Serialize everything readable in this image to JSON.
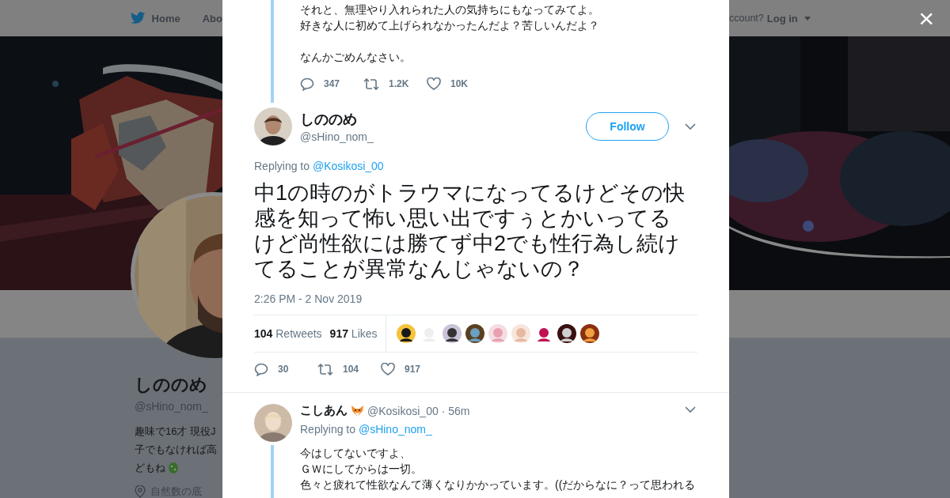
{
  "background_page": {
    "nav": {
      "home": "Home",
      "about": "Abo",
      "account_prompt": "ccount?",
      "login": "Log in"
    },
    "profile": {
      "name": "しののめ",
      "handle": "@sHino_nom_",
      "bio": [
        "趣味で16才 現役J",
        "子でもなければ高",
        "どもね"
      ],
      "location": "自然数の底"
    }
  },
  "close_button": "×",
  "previous_tweet": {
    "paragraphs": [
      [
        "それと、無理やり入れられた人の気持ちにもなってみてよ。",
        "好きな人に初めて上げられなかったんだよ？苦しいんだよ？"
      ],
      [
        "なんかごめんなさい。"
      ]
    ],
    "actions": {
      "replies": "347",
      "retweets": "1.2K",
      "likes": "10K"
    }
  },
  "main_tweet": {
    "name": "しののめ",
    "handle": "@sHino_nom_",
    "follow_button": "Follow",
    "replying_label": "Replying to",
    "replying_to": "@Kosikosi_00",
    "text": "中1の時のがトラウマになってるけどその快感を知って怖い思い出ですぅとかいってるけど尚性欲には勝てず中2でも性行為し続けてることが異常なんじゃないの？",
    "timestamp": "2:26 PM - 2 Nov 2019",
    "retweet_count": "104",
    "retweet_label": "Retweets",
    "like_count": "917",
    "like_label": "Likes",
    "actions": {
      "replies": "30",
      "retweets": "104",
      "likes": "917"
    }
  },
  "reply_tweet": {
    "name": "こしあん",
    "handle": "@Kosikosi_00",
    "time": "· 56m",
    "replying_label": "Replying to",
    "replying_to": "@sHino_nom_",
    "lines": [
      "今はしてないですよ、",
      "ＧＷにしてからは一切。",
      "色々と疲れて性欲なんて薄くなりかかっています。((だからなに？って思われる"
    ]
  }
}
